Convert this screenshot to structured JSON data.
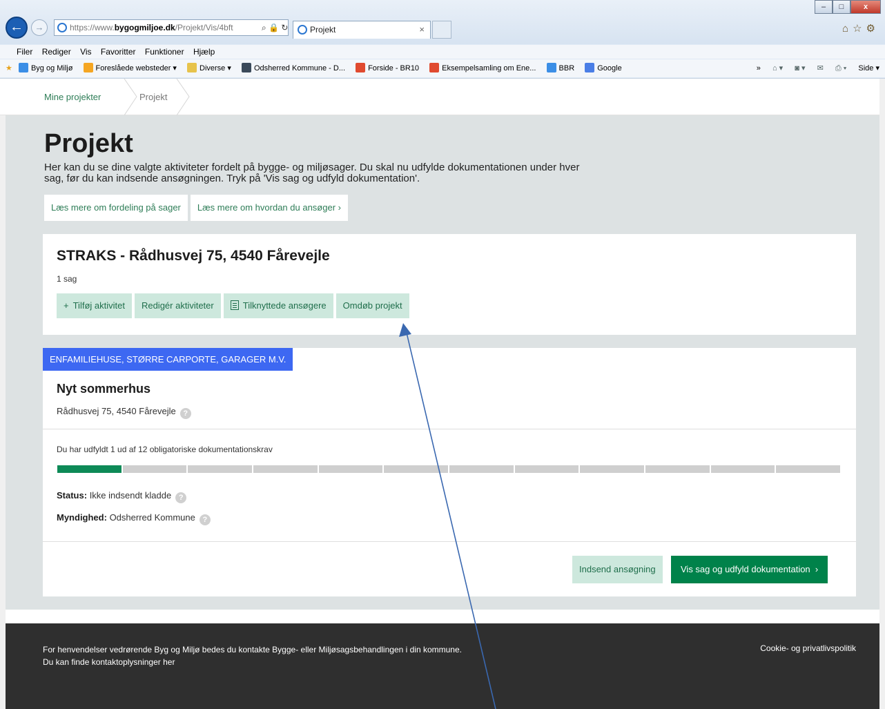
{
  "browser": {
    "url_prefix": "https://www.",
    "url_domain": "bygogmiljoe.dk",
    "url_path": "/Projekt/Vis/4bft",
    "tab_title": "Projekt",
    "tab_close": "×",
    "window_controls": [
      "–",
      "□",
      "x"
    ],
    "menu": [
      "Filer",
      "Rediger",
      "Vis",
      "Favoritter",
      "Funktioner",
      "Hjælp"
    ],
    "favorites": [
      {
        "label": "Byg og Miljø",
        "icon": "ie-page-icon",
        "color": "#3b8ee6"
      },
      {
        "label": "Foreslåede websteder ▾",
        "icon": "bing-icon",
        "color": "#f5a623"
      },
      {
        "label": "Diverse ▾",
        "icon": "folder-icon",
        "color": "#e7c34b"
      },
      {
        "label": "Odsherred Kommune - D...",
        "icon": "od-logo-icon",
        "color": "#3b4a5a"
      },
      {
        "label": "Forside - BR10",
        "icon": "br10-grid-icon",
        "color": "#e04a2f"
      },
      {
        "label": "Eksempelsamling om Ene...",
        "icon": "br10-grid-icon",
        "color": "#e04a2f"
      },
      {
        "label": "BBR",
        "icon": "ie-page-icon",
        "color": "#3b8ee6"
      },
      {
        "label": "Google",
        "icon": "google-icon",
        "color": "#4a7ee6"
      }
    ],
    "toolbar_right_label": "Side ▾",
    "overflow_chevron": "»"
  },
  "breadcrumb": {
    "items": [
      {
        "label": "Mine projekter"
      },
      {
        "label": "Projekt"
      }
    ]
  },
  "page": {
    "title": "Projekt",
    "intro": "Her kan du se dine valgte aktiviteter fordelt på bygge- og miljøsager. Du skal nu udfylde dokumentationen under hver sag, før du kan indsende ansøgningen. Tryk på 'Vis sag og udfyld dokumentation'.",
    "info_links": [
      {
        "label": "Læs mere om fordeling på sager"
      },
      {
        "label": "Læs mere om hvordan du ansøger",
        "chevron": "›"
      }
    ]
  },
  "project": {
    "title": "STRAKS - Rådhusvej 75, 4540 Fårevejle",
    "count": "1 sag",
    "actions": {
      "add_icon": "+",
      "add": "Tilføj aktivitet",
      "edit": "Redigér aktiviteter",
      "applicants": "Tilknyttede ansøgere",
      "rename": "Omdøb projekt"
    }
  },
  "case": {
    "badge": "ENFAMILIEHUSE, STØRRE CARPORTE, GARAGER M.V.",
    "title": "Nyt sommerhus",
    "address": "Rådhusvej 75, 4540 Fårevejle",
    "help_glyph": "?",
    "progress_text": "Du har udfyldt 1 ud af 12 obligatoriske dokumentationskrav",
    "progress": {
      "filled": 1,
      "total": 12
    },
    "status_label": "Status:",
    "status_value": "Ikke indsendt kladde",
    "authority_label": "Myndighed:",
    "authority_value": "Odsherred Kommune",
    "submit_button": "Indsend ansøgning",
    "view_button": "Vis sag og udfyld dokumentation",
    "view_chevron": "›"
  },
  "footer": {
    "text_line1": "For henvendelser vedrørende Byg og Miljø bedes du kontakte Bygge- eller Miljøsagsbehandlingen i din kommune.",
    "text_line2": "Du kan finde kontaktoplysninger her",
    "cookie_link": "Cookie- og privatlivspolitik"
  },
  "colors": {
    "accent_green": "#00824a",
    "light_green": "#cde8dd",
    "badge_blue": "#3d68f2",
    "arrow_blue": "#3a68b0"
  }
}
